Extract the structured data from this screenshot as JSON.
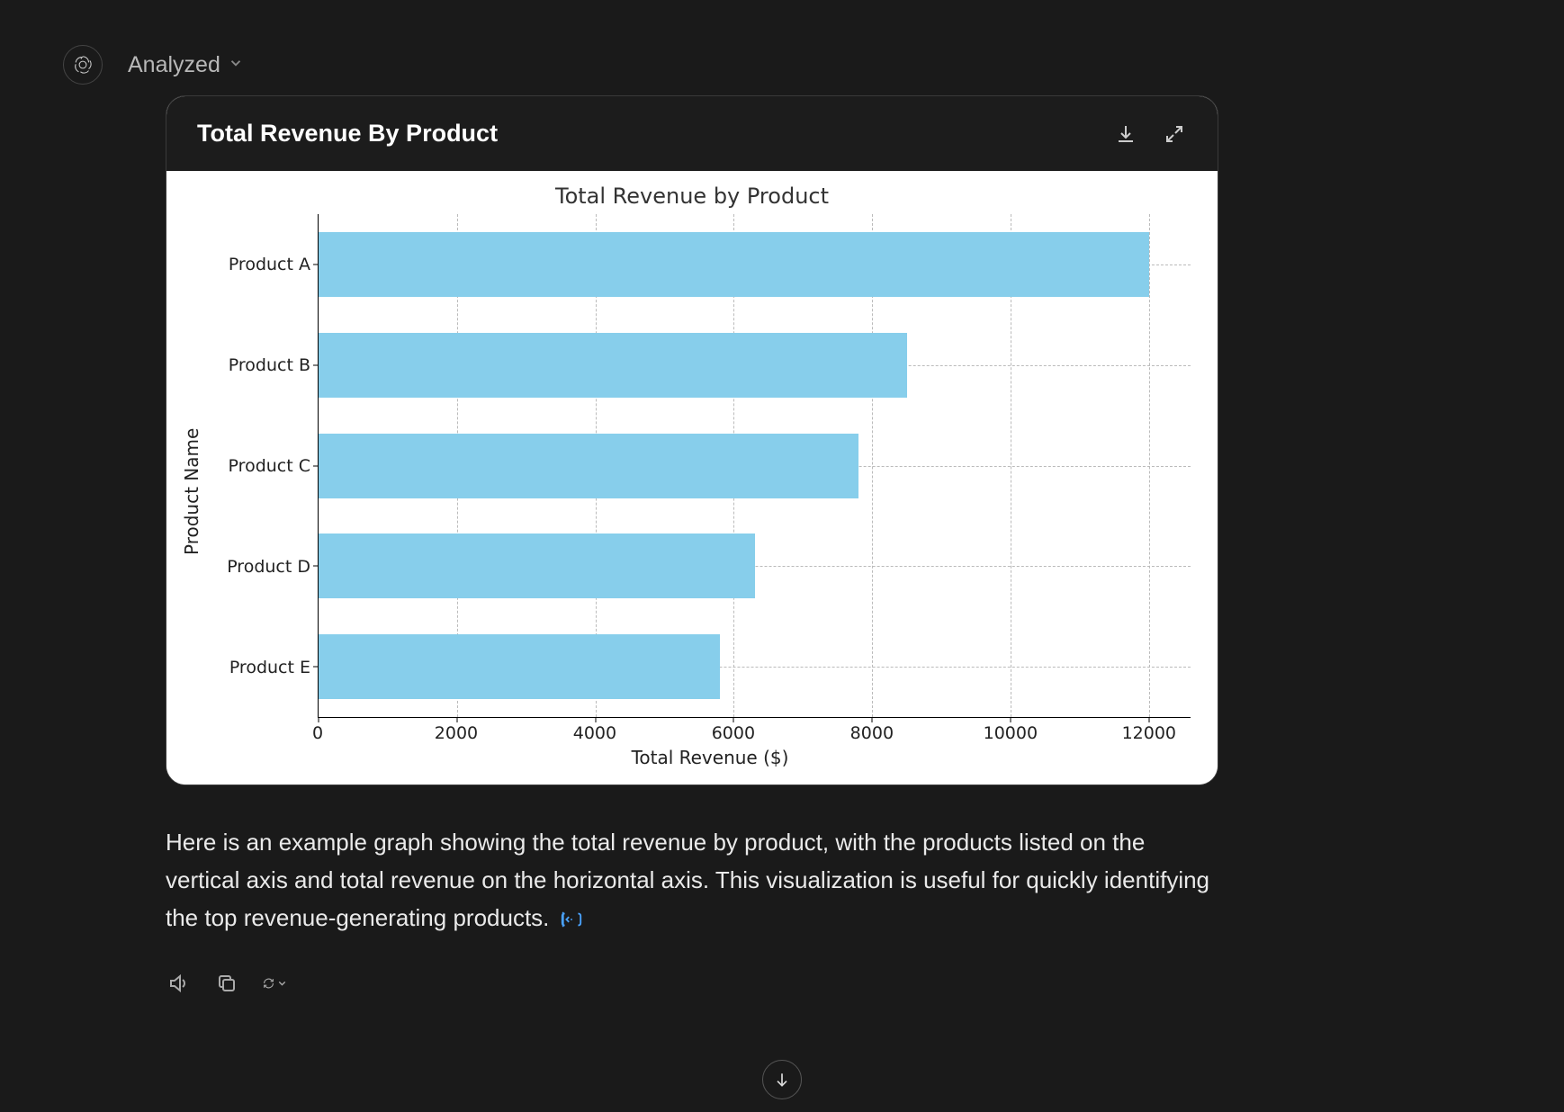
{
  "header": {
    "status_label": "Analyzed"
  },
  "card": {
    "title": "Total Revenue By Product"
  },
  "chart_data": {
    "type": "bar",
    "orientation": "horizontal",
    "title": "Total Revenue by Product",
    "xlabel": "Total Revenue ($)",
    "ylabel": "Product Name",
    "categories": [
      "Product A",
      "Product B",
      "Product C",
      "Product D",
      "Product E"
    ],
    "values": [
      12000,
      8500,
      7800,
      6300,
      5800
    ],
    "xticks": [
      0,
      2000,
      4000,
      6000,
      8000,
      10000,
      12000
    ],
    "xlim": [
      0,
      12600
    ],
    "bar_color": "#87ceeb",
    "grid": true
  },
  "caption": {
    "text": "Here is an example graph showing the total revenue by product, with the products listed on the vertical axis and total revenue on the horizontal axis. This visualization is useful for quickly identifying the top revenue-generating products."
  }
}
